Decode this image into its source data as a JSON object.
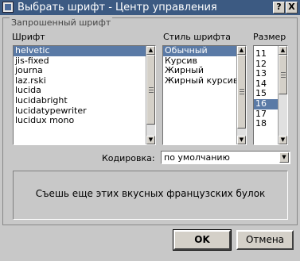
{
  "window": {
    "title": "Выбрать шрифт - Центр управления",
    "help_label": "?",
    "close_label": "X"
  },
  "group": {
    "title": "Запрошенный шрифт"
  },
  "font_list": {
    "label": "Шрифт",
    "items": [
      "helvetic",
      "jis-fixed",
      "journa",
      "laz.rski",
      "lucida",
      "lucidabright",
      "lucidatypewriter",
      "lucidux mono"
    ],
    "selected": "helvetic"
  },
  "style_list": {
    "label": "Стиль шрифта",
    "items": [
      "Обычный",
      "Курсив",
      "Жирный",
      "Жирный курсив"
    ],
    "selected": "Обычный"
  },
  "size_list": {
    "label": "Размер",
    "items": [
      "11",
      "12",
      "13",
      "14",
      "15",
      "16",
      "17",
      "18"
    ],
    "selected": "16"
  },
  "encoding": {
    "label": "Кодировка:",
    "value": "по умолчанию"
  },
  "preview": {
    "text": "Съешь еще этих вкусных французских булок"
  },
  "buttons": {
    "ok": "OK",
    "cancel": "Отмена"
  },
  "icons": {
    "app": "window-app-icon",
    "scroll_up": "arrow-up-icon",
    "scroll_down": "arrow-down-icon",
    "combo": "chevron-down-icon"
  }
}
